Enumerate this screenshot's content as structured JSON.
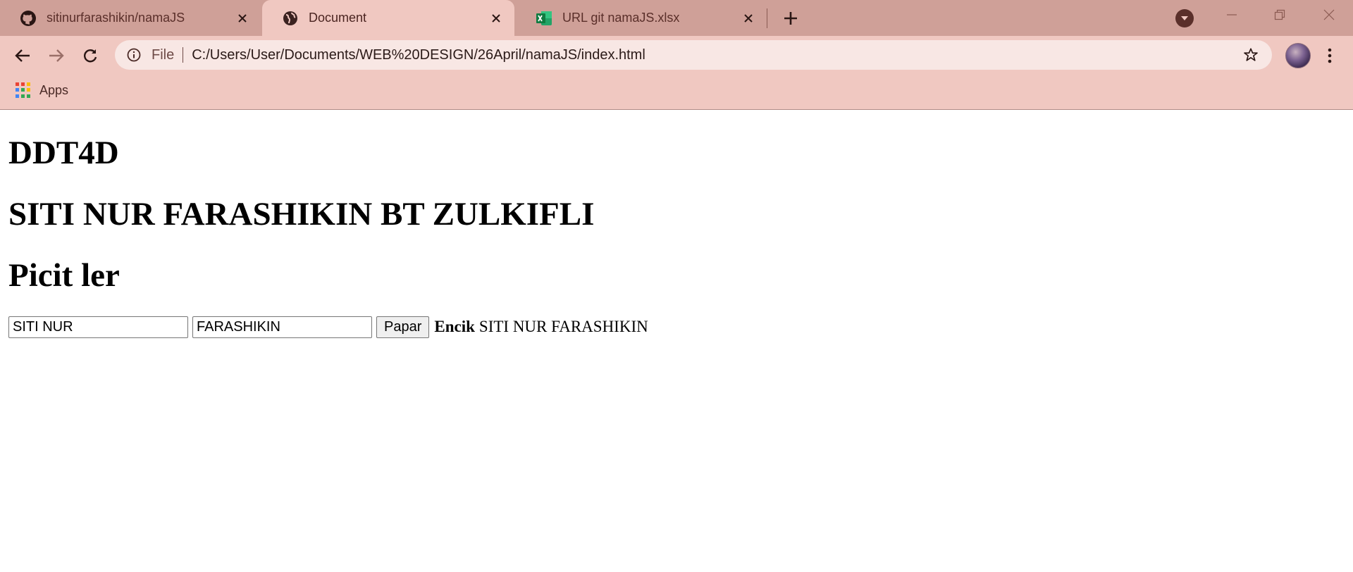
{
  "browser": {
    "tabs": [
      {
        "title": "sitinurfarashikin/namaJS",
        "icon": "github-icon",
        "active": false
      },
      {
        "title": "Document",
        "icon": "globe-icon",
        "active": true
      },
      {
        "title": "URL git namaJS.xlsx",
        "icon": "excel-icon",
        "active": false
      }
    ],
    "address": {
      "scheme_label": "File",
      "url": "C:/Users/User/Documents/WEB%20DESIGN/26April/namaJS/index.html"
    },
    "bookmarks": {
      "apps_label": "Apps"
    },
    "colors": {
      "tabstrip": "#cfa098",
      "toolbar": "#f0c8c1"
    }
  },
  "page": {
    "heading1": "DDT4D",
    "heading2": "SITI NUR FARASHIKIN BT ZULKIFLI",
    "heading3": "Picit ler",
    "form": {
      "first_name_value": "SITI NUR",
      "last_name_value": "FARASHIKIN",
      "button_label": "Papar",
      "output_prefix": "Encik",
      "output_value": "SITI NUR FARASHIKIN"
    }
  }
}
